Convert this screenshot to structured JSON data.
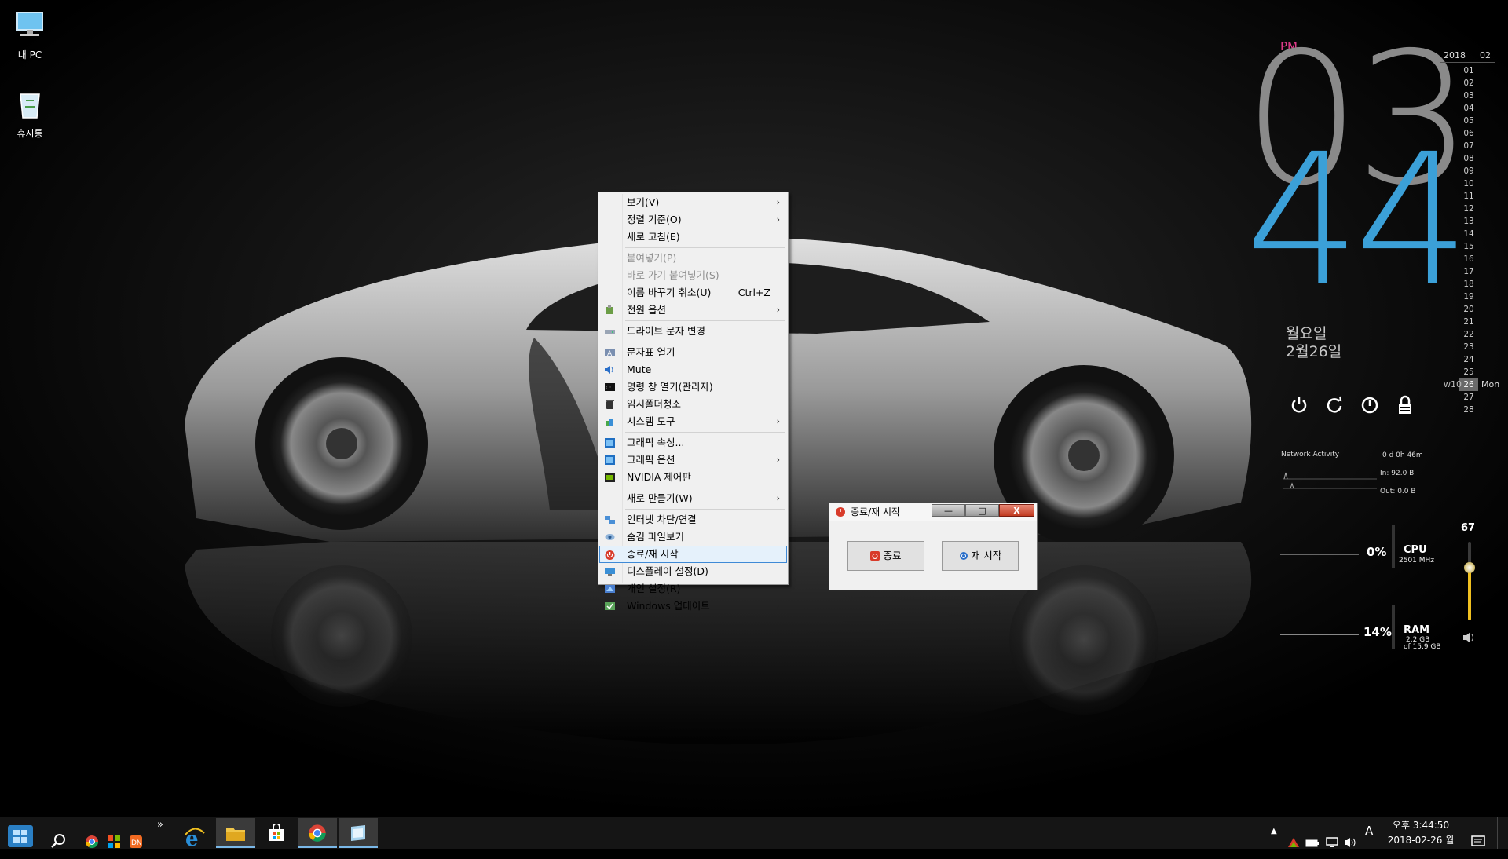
{
  "desktop": {
    "icons": [
      {
        "label": "내 PC",
        "icon": "computer-icon"
      },
      {
        "label": "휴지통",
        "icon": "recycle-bin-icon"
      }
    ]
  },
  "context_menu": {
    "view": "보기(V)",
    "sort_by": "정렬 기준(O)",
    "refresh": "새로 고침(E)",
    "paste": "붙여넣기(P)",
    "paste_shortcut": "바로 가기 붙여넣기(S)",
    "undo_rename": "이름 바꾸기 취소(U)",
    "undo_rename_shortcut": "Ctrl+Z",
    "power_options": "전원 옵션",
    "change_drive_letter": "드라이브 문자 변경",
    "character_map": "문자표 열기",
    "mute": "Mute",
    "cmd_admin": "명령 창 열기(관리자)",
    "temp_cleanup": "임시폴더청소",
    "system_tools": "시스템 도구",
    "graphics_properties": "그래픽 속성...",
    "graphics_options": "그래픽 옵션",
    "nvidia_panel": "NVIDIA 제어판",
    "new": "새로 만들기(W)",
    "internet_block": "인터넷 차단/연결",
    "hidden_files": "숨김 파일보기",
    "shutdown_restart": "종료/재 시작",
    "display_settings": "디스플레이 설정(D)",
    "personalize": "개인 설정(R)",
    "windows_update": "Windows 업데이트"
  },
  "dialog": {
    "title": "종료/재 시작",
    "shutdown": "종료",
    "restart": "재 시작",
    "min": "—",
    "max": "□",
    "close": "X"
  },
  "clock": {
    "ampm": "PM",
    "hour": "03",
    "minute": "44",
    "weekday": "월요일",
    "date": "2월26일"
  },
  "calendar": {
    "year": "2018",
    "month": "02",
    "days": [
      "01",
      "02",
      "03",
      "04",
      "05",
      "06",
      "07",
      "08",
      "09",
      "10",
      "11",
      "12",
      "13",
      "14",
      "15",
      "16",
      "17",
      "18",
      "19",
      "20",
      "21",
      "22",
      "23",
      "24",
      "25",
      "26",
      "27",
      "28"
    ],
    "today": "26",
    "week": "w10",
    "dayname": "Mon"
  },
  "network": {
    "title": "Network Activity",
    "uptime": "0 d 0h 46m",
    "in": "In: 92.0 B",
    "out": "Out: 0.0 B"
  },
  "cpu": {
    "percent": "0%",
    "label": "CPU",
    "freq": "2501 MHz"
  },
  "ram": {
    "percent": "14%",
    "label": "RAM",
    "used": "2.2 GB",
    "total": "of 15.9 GB"
  },
  "volume": {
    "value": "67",
    "level": 0.67
  },
  "taskbar": {
    "time": "오후 3:44:50",
    "date": "2018-02-26 월",
    "ime": "A",
    "chevron": "»"
  },
  "colors": {
    "clock_hour": "#8a8a8a",
    "clock_minute": "#3ba0d8",
    "ampm": "#e23c8c",
    "volume": "#f0c020"
  }
}
